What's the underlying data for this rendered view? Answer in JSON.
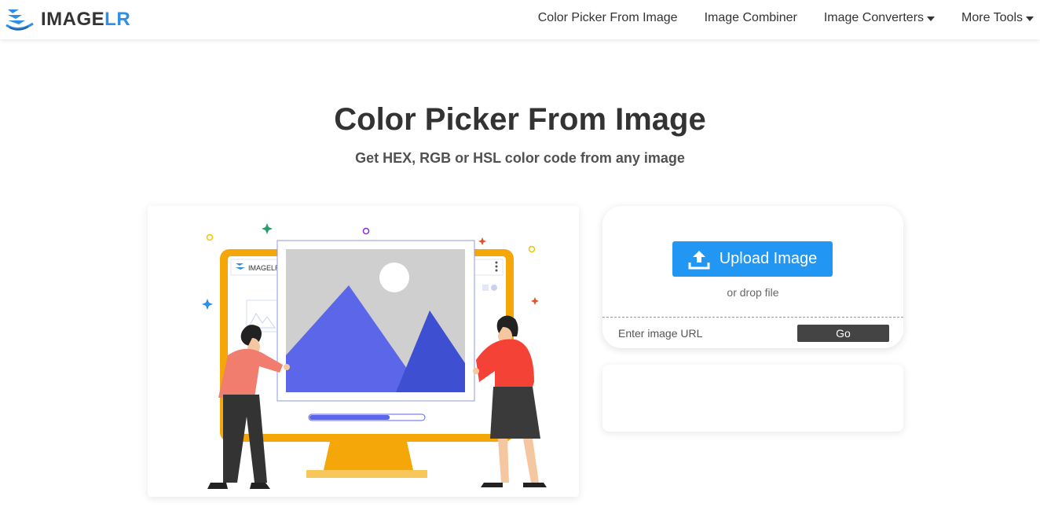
{
  "header": {
    "logo_text_main": "IMAGE",
    "logo_text_accent": "LR",
    "logo_icon": "imagelr-logo-icon",
    "nav": [
      {
        "label": "Color Picker From Image",
        "has_dropdown": false
      },
      {
        "label": "Image Combiner",
        "has_dropdown": false
      },
      {
        "label": "Image Converters",
        "has_dropdown": true
      },
      {
        "label": "More Tools",
        "has_dropdown": true
      }
    ]
  },
  "hero": {
    "title": "Color Picker From Image",
    "subtitle": "Get HEX, RGB or HSL color code from any image"
  },
  "illustration": {
    "mini_logo_text": "IMAGELR",
    "progress_fraction": 0.7
  },
  "upload": {
    "button_label": "Upload Image",
    "button_icon": "upload-icon",
    "drop_text": "or drop file",
    "url_placeholder": "Enter image URL",
    "go_label": "Go"
  },
  "colors": {
    "accent": "#2196f3",
    "logo_accent": "#2d8fe6",
    "go_button": "#444444",
    "monitor": "#f5a70a",
    "mountain": "#5b67e8",
    "mountain_dark": "#3f4fd1"
  }
}
